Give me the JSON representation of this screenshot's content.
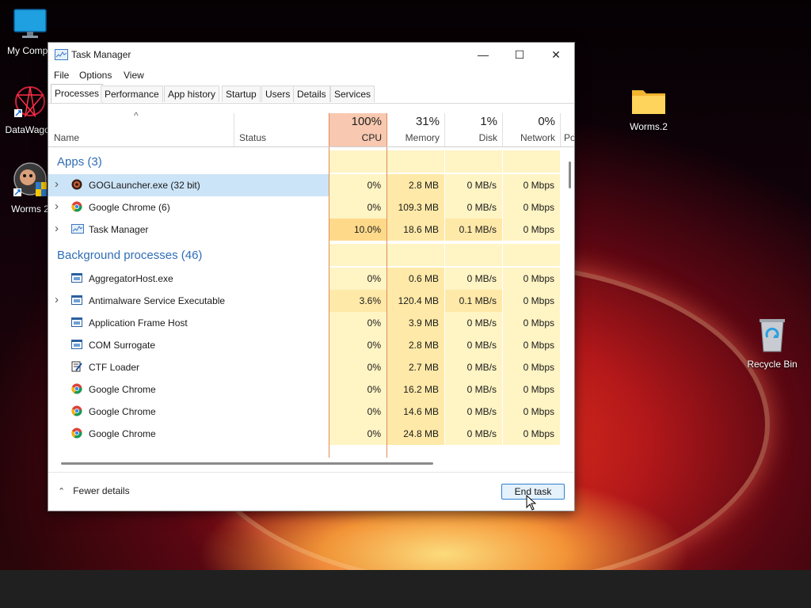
{
  "desktop": {
    "icons": [
      {
        "label": "My Compu",
        "icon": "monitor-icon"
      },
      {
        "label": "DataWagon",
        "icon": "datawagon-icon"
      },
      {
        "label": "Worms 2",
        "icon": "worms-icon"
      },
      {
        "label": "Worms.2",
        "icon": "folder-icon"
      },
      {
        "label": "Recycle Bin",
        "icon": "recycle-bin-icon"
      }
    ]
  },
  "window": {
    "title": "Task Manager",
    "controls": {
      "minimize": "—",
      "maximize": "☐",
      "close": "✕"
    },
    "menu": [
      "File",
      "Options",
      "View"
    ],
    "tabs": [
      "Processes",
      "Performance",
      "App history",
      "Startup",
      "Users",
      "Details",
      "Services"
    ],
    "active_tab": "Processes"
  },
  "table": {
    "sort_indicator": "^",
    "columns": {
      "name": "Name",
      "status": "Status",
      "cpu": {
        "pct": "100%",
        "label": "CPU"
      },
      "memory": {
        "pct": "31%",
        "label": "Memory"
      },
      "disk": {
        "pct": "1%",
        "label": "Disk"
      },
      "network": {
        "pct": "0%",
        "label": "Network"
      },
      "power": "Po"
    },
    "groups": {
      "apps": "Apps (3)",
      "background": "Background processes (46)"
    },
    "apps": [
      {
        "name": "GOGLauncher.exe (32 bit)",
        "cpu": "0%",
        "memory": "2.8 MB",
        "disk": "0 MB/s",
        "network": "0 Mbps",
        "icon": "gog-icon",
        "expandable": true,
        "selected": true
      },
      {
        "name": "Google Chrome (6)",
        "cpu": "0%",
        "memory": "109.3 MB",
        "disk": "0 MB/s",
        "network": "0 Mbps",
        "icon": "chrome-icon",
        "expandable": true
      },
      {
        "name": "Task Manager",
        "cpu": "10.0%",
        "memory": "18.6 MB",
        "disk": "0.1 MB/s",
        "network": "0 Mbps",
        "icon": "task-manager-icon",
        "expandable": true
      }
    ],
    "background": [
      {
        "name": "AggregatorHost.exe",
        "cpu": "0%",
        "memory": "0.6 MB",
        "disk": "0 MB/s",
        "network": "0 Mbps",
        "icon": "window-app-icon"
      },
      {
        "name": "Antimalware Service Executable",
        "cpu": "3.6%",
        "memory": "120.4 MB",
        "disk": "0.1 MB/s",
        "network": "0 Mbps",
        "icon": "window-app-icon",
        "expandable": true
      },
      {
        "name": "Application Frame Host",
        "cpu": "0%",
        "memory": "3.9 MB",
        "disk": "0 MB/s",
        "network": "0 Mbps",
        "icon": "window-app-icon"
      },
      {
        "name": "COM Surrogate",
        "cpu": "0%",
        "memory": "2.8 MB",
        "disk": "0 MB/s",
        "network": "0 Mbps",
        "icon": "window-app-icon"
      },
      {
        "name": "CTF Loader",
        "cpu": "0%",
        "memory": "2.7 MB",
        "disk": "0 MB/s",
        "network": "0 Mbps",
        "icon": "ctf-loader-icon"
      },
      {
        "name": "Google Chrome",
        "cpu": "0%",
        "memory": "16.2 MB",
        "disk": "0 MB/s",
        "network": "0 Mbps",
        "icon": "chrome-icon"
      },
      {
        "name": "Google Chrome",
        "cpu": "0%",
        "memory": "14.6 MB",
        "disk": "0 MB/s",
        "network": "0 Mbps",
        "icon": "chrome-icon"
      },
      {
        "name": "Google Chrome",
        "cpu": "0%",
        "memory": "24.8 MB",
        "disk": "0 MB/s",
        "network": "0 Mbps",
        "icon": "chrome-icon"
      }
    ]
  },
  "footer": {
    "fewer_details": "Fewer details",
    "end_task": "End task"
  },
  "colors": {
    "selection": "#cce4f7",
    "cpu_header": "#f8c8b0",
    "heat_light": "#fff4c4",
    "heat_medium": "#ffe9a8",
    "accent_blue": "#2f6db5"
  }
}
